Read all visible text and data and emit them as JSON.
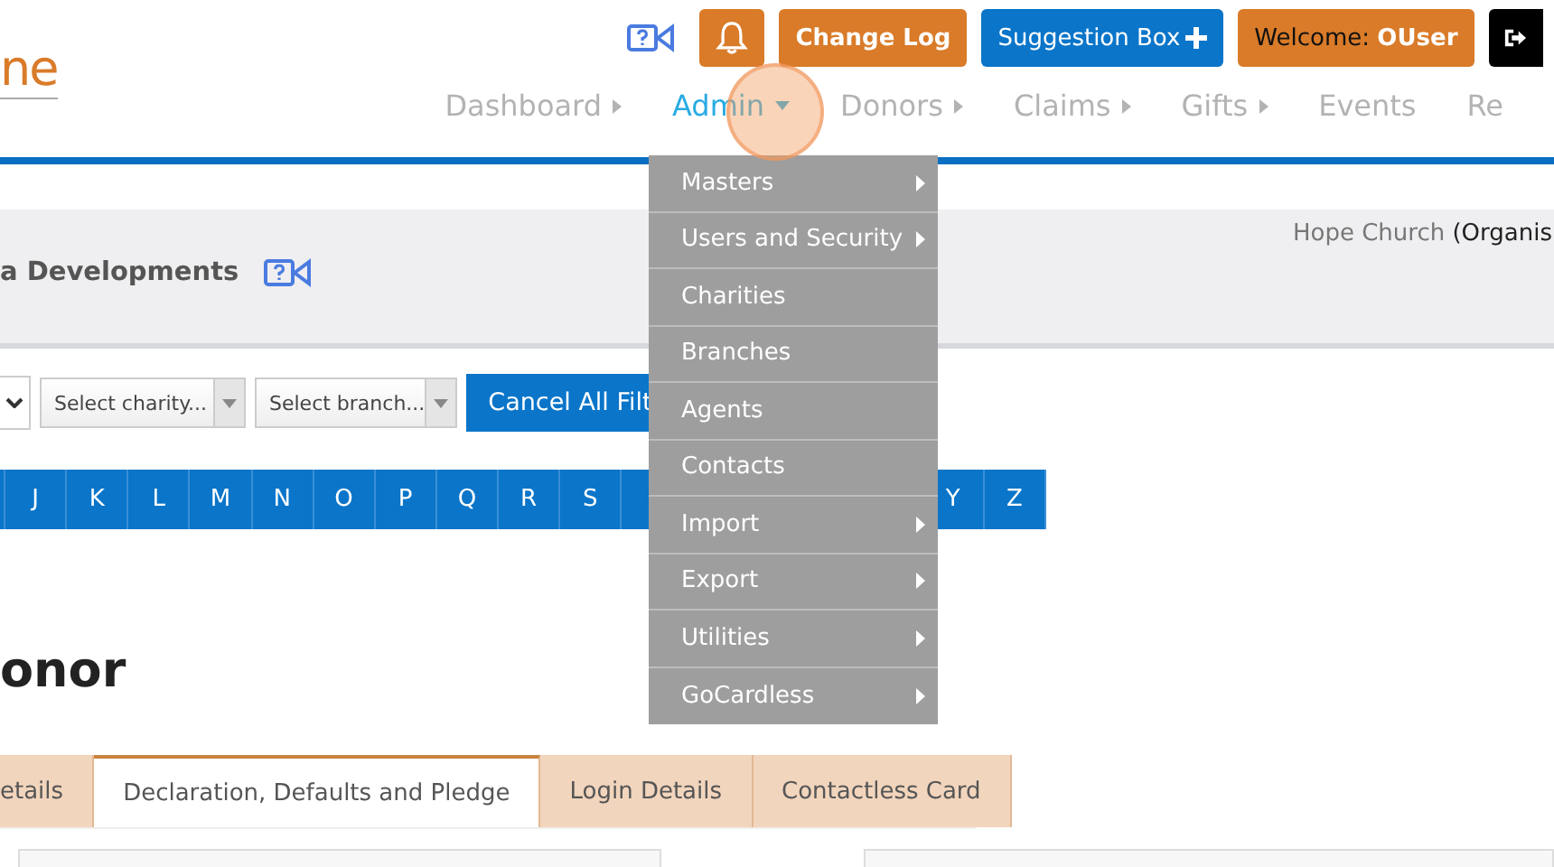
{
  "logo": {
    "text": "ne"
  },
  "top_buttons": [
    {
      "kind": "video"
    },
    {
      "kind": "bell"
    },
    {
      "kind": "changelog",
      "label": "Change Log"
    },
    {
      "kind": "suggestion",
      "label": "Suggestion Box"
    },
    {
      "kind": "welcome",
      "label": "Welcome:",
      "user": "OUser"
    },
    {
      "kind": "logout"
    }
  ],
  "nav": [
    {
      "label": "Dashboard",
      "kind": "submenu",
      "selected": false
    },
    {
      "label": "Admin",
      "kind": "dropdown",
      "selected": true
    },
    {
      "label": "Donors",
      "kind": "submenu",
      "selected": false
    },
    {
      "label": "Claims",
      "kind": "submenu",
      "selected": false
    },
    {
      "label": "Gifts",
      "kind": "submenu",
      "selected": false
    },
    {
      "label": "Events",
      "kind": "link",
      "selected": false
    },
    {
      "label": "Re",
      "kind": "link",
      "selected": false
    }
  ],
  "admin_menu": [
    {
      "label": "Masters",
      "submenu": true
    },
    {
      "label": "Users and Security",
      "submenu": true
    },
    {
      "label": "Charities",
      "submenu": false
    },
    {
      "label": "Branches",
      "submenu": false
    },
    {
      "label": "Agents",
      "submenu": false
    },
    {
      "label": "Contacts",
      "submenu": false
    },
    {
      "label": "Import",
      "submenu": true
    },
    {
      "label": "Export",
      "submenu": true
    },
    {
      "label": "Utilities",
      "submenu": true
    },
    {
      "label": "GoCardless",
      "submenu": true
    }
  ],
  "header": {
    "title": "a Developments",
    "org_name": "Hope Church",
    "org_type": "(Organis"
  },
  "filters": {
    "selects": [
      {
        "kind": "cut"
      },
      {
        "kind": "combo",
        "placeholder": "Select charity..."
      },
      {
        "kind": "combo",
        "placeholder": "Select branch..."
      }
    ],
    "cancel_button": "Cancel All Filt"
  },
  "alphabet_left": [
    "J",
    "K",
    "L",
    "M",
    "N",
    "O",
    "P",
    "Q",
    "R",
    "S"
  ],
  "alphabet_right": [
    "Y",
    "Z"
  ],
  "page_title": "onor",
  "tabs": [
    {
      "label": "etails",
      "selected": false
    },
    {
      "label": "Declaration, Defaults and Pledge",
      "selected": true
    },
    {
      "label": "Login Details",
      "selected": false
    },
    {
      "label": "Contactless Card",
      "selected": false
    }
  ]
}
